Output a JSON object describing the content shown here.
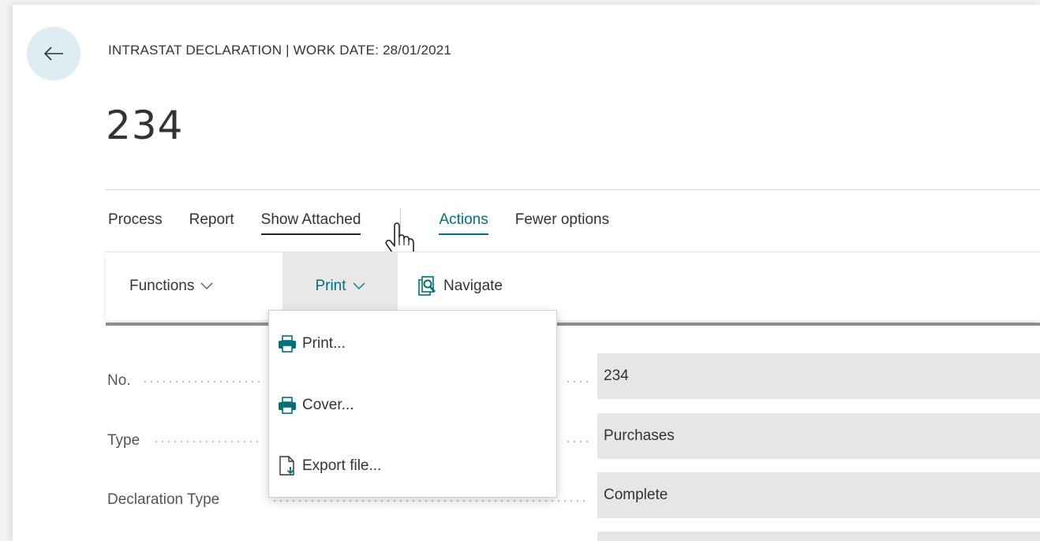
{
  "header": {
    "caption": "INTRASTAT DECLARATION | WORK DATE: 28/01/2021",
    "title": "234"
  },
  "tabs": [
    {
      "label": "Process"
    },
    {
      "label": "Report"
    },
    {
      "label": "Show Attached"
    },
    {
      "label": "Actions"
    },
    {
      "label": "Fewer options"
    }
  ],
  "actionbar": {
    "functions_label": "Functions",
    "print_label": "Print",
    "navigate_label": "Navigate"
  },
  "print_menu": [
    {
      "label": "Print...",
      "icon": "printer-icon"
    },
    {
      "label": "Cover...",
      "icon": "printer-icon"
    },
    {
      "label": "Export file...",
      "icon": "export-file-icon"
    }
  ],
  "fields": [
    {
      "label": "No.",
      "value": "234"
    },
    {
      "label": "Type",
      "value": "Purchases"
    },
    {
      "label": "Declaration Type",
      "value": "Complete"
    }
  ],
  "colors": {
    "accent": "#00707a",
    "back_button_bg": "#dcecf0",
    "field_bg": "#e6e6e6"
  }
}
